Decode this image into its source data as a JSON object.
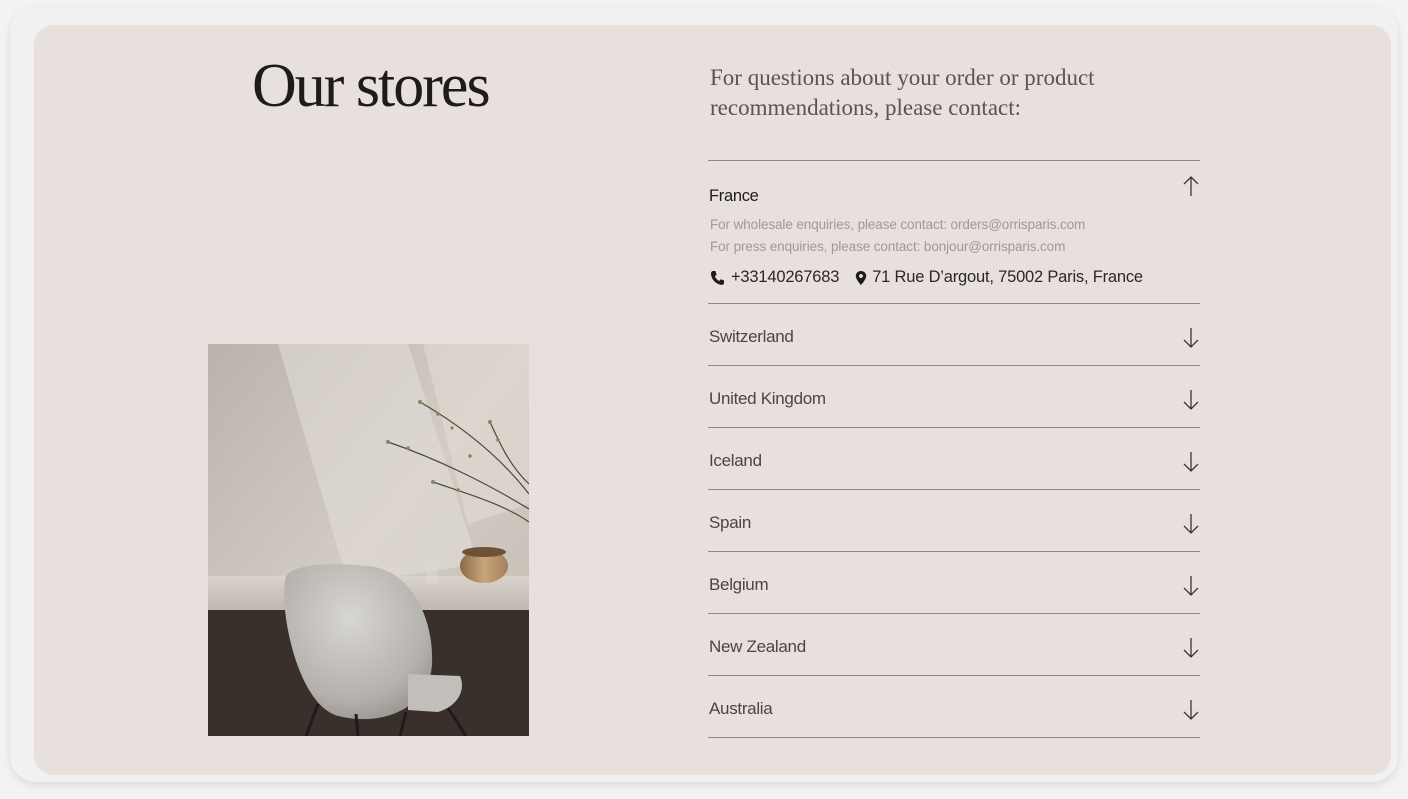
{
  "page": {
    "title": "Our stores",
    "intro": "For questions about your order or product recommendations, please contact:"
  },
  "photo": {
    "alt": "Boucle chair at a desk with branches in a vase"
  },
  "stores": [
    {
      "country": "France",
      "expanded": true,
      "wholesale": "For wholesale enquiries, please contact: orders@orrisparis.com",
      "press": "For press enquiries, please contact: bonjour@orrisparis.com",
      "phone": "+33140267683",
      "address": "71 Rue D’argout, 75002 Paris, France"
    },
    {
      "country": "Switzerland",
      "expanded": false
    },
    {
      "country": "United Kingdom",
      "expanded": false
    },
    {
      "country": "Iceland",
      "expanded": false
    },
    {
      "country": "Spain",
      "expanded": false
    },
    {
      "country": "Belgium",
      "expanded": false
    },
    {
      "country": "New Zealand",
      "expanded": false
    },
    {
      "country": "Australia",
      "expanded": false
    }
  ],
  "icons": {
    "expanded_arrow": "arrow-up-icon",
    "collapsed_arrow": "arrow-down-icon",
    "phone": "phone-icon",
    "location": "map-pin-icon"
  },
  "colors": {
    "card_background": "#e7e0dc",
    "divider": "#8e8985",
    "text_dark": "#1e1c1b",
    "text_muted": "#9f9a96"
  }
}
